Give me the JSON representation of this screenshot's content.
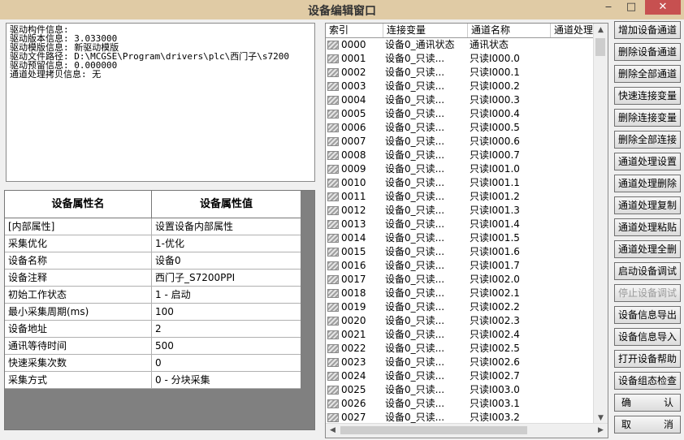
{
  "window": {
    "title": "设备编辑窗口"
  },
  "window_buttons": {
    "minimize": "‒",
    "maximize": "□",
    "close": "✕"
  },
  "info_lines": [
    "驱动构件信息:",
    "驱动版本信息: 3.033000",
    "驱动模版信息: 新驱动模版",
    "驱动文件路径: D:\\MCGSE\\Program\\drivers\\plc\\西门子\\s7200",
    "驱动预留信息: 0.000000",
    "通道处理拷贝信息: 无"
  ],
  "properties": {
    "header_name": "设备属性名",
    "header_value": "设备属性值",
    "rows": [
      {
        "name": "[内部属性]",
        "value": "设置设备内部属性"
      },
      {
        "name": "采集优化",
        "value": "1-优化"
      },
      {
        "name": "设备名称",
        "value": "设备0"
      },
      {
        "name": "设备注释",
        "value": "西门子_S7200PPI"
      },
      {
        "name": "初始工作状态",
        "value": "1 - 启动"
      },
      {
        "name": "最小采集周期(ms)",
        "value": "100"
      },
      {
        "name": "设备地址",
        "value": "2"
      },
      {
        "name": "通讯等待时间",
        "value": "500"
      },
      {
        "name": "快速采集次数",
        "value": "0"
      },
      {
        "name": "采集方式",
        "value": "0 - 分块采集"
      }
    ]
  },
  "channels": {
    "columns": [
      "索引",
      "连接变量",
      "通道名称",
      "通道处理"
    ],
    "rows": [
      {
        "index": "0000",
        "var": "设备0_通讯状态",
        "name": "通讯状态"
      },
      {
        "index": "0001",
        "var": "设备0_只读...",
        "name": "只读I000.0"
      },
      {
        "index": "0002",
        "var": "设备0_只读...",
        "name": "只读I000.1"
      },
      {
        "index": "0003",
        "var": "设备0_只读...",
        "name": "只读I000.2"
      },
      {
        "index": "0004",
        "var": "设备0_只读...",
        "name": "只读I000.3"
      },
      {
        "index": "0005",
        "var": "设备0_只读...",
        "name": "只读I000.4"
      },
      {
        "index": "0006",
        "var": "设备0_只读...",
        "name": "只读I000.5"
      },
      {
        "index": "0007",
        "var": "设备0_只读...",
        "name": "只读I000.6"
      },
      {
        "index": "0008",
        "var": "设备0_只读...",
        "name": "只读I000.7"
      },
      {
        "index": "0009",
        "var": "设备0_只读...",
        "name": "只读I001.0"
      },
      {
        "index": "0010",
        "var": "设备0_只读...",
        "name": "只读I001.1"
      },
      {
        "index": "0011",
        "var": "设备0_只读...",
        "name": "只读I001.2"
      },
      {
        "index": "0012",
        "var": "设备0_只读...",
        "name": "只读I001.3"
      },
      {
        "index": "0013",
        "var": "设备0_只读...",
        "name": "只读I001.4"
      },
      {
        "index": "0014",
        "var": "设备0_只读...",
        "name": "只读I001.5"
      },
      {
        "index": "0015",
        "var": "设备0_只读...",
        "name": "只读I001.6"
      },
      {
        "index": "0016",
        "var": "设备0_只读...",
        "name": "只读I001.7"
      },
      {
        "index": "0017",
        "var": "设备0_只读...",
        "name": "只读I002.0"
      },
      {
        "index": "0018",
        "var": "设备0_只读...",
        "name": "只读I002.1"
      },
      {
        "index": "0019",
        "var": "设备0_只读...",
        "name": "只读I002.2"
      },
      {
        "index": "0020",
        "var": "设备0_只读...",
        "name": "只读I002.3"
      },
      {
        "index": "0021",
        "var": "设备0_只读...",
        "name": "只读I002.4"
      },
      {
        "index": "0022",
        "var": "设备0_只读...",
        "name": "只读I002.5"
      },
      {
        "index": "0023",
        "var": "设备0_只读...",
        "name": "只读I002.6"
      },
      {
        "index": "0024",
        "var": "设备0_只读...",
        "name": "只读I002.7"
      },
      {
        "index": "0025",
        "var": "设备0_只读...",
        "name": "只读I003.0"
      },
      {
        "index": "0026",
        "var": "设备0_只读...",
        "name": "只读I003.1"
      },
      {
        "index": "0027",
        "var": "设备0_只读...",
        "name": "只读I003.2"
      }
    ]
  },
  "buttons": [
    {
      "label": "增加设备通道",
      "disabled": false
    },
    {
      "label": "删除设备通道",
      "disabled": false
    },
    {
      "label": "删除全部通道",
      "disabled": false
    },
    {
      "label": "快速连接变量",
      "disabled": false
    },
    {
      "label": "删除连接变量",
      "disabled": false
    },
    {
      "label": "删除全部连接",
      "disabled": false
    },
    {
      "label": "通道处理设置",
      "disabled": false
    },
    {
      "label": "通道处理删除",
      "disabled": false
    },
    {
      "label": "通道处理复制",
      "disabled": false
    },
    {
      "label": "通道处理粘贴",
      "disabled": false
    },
    {
      "label": "通道处理全删",
      "disabled": false
    },
    {
      "label": "启动设备调试",
      "disabled": false
    },
    {
      "label": "停止设备调试",
      "disabled": true
    },
    {
      "label": "设备信息导出",
      "disabled": false
    },
    {
      "label": "设备信息导入",
      "disabled": false
    },
    {
      "label": "打开设备帮助",
      "disabled": false
    },
    {
      "label": "设备组态检查",
      "disabled": false
    }
  ],
  "confirm_buttons": [
    {
      "left": "确",
      "right": "认"
    },
    {
      "left": "取",
      "right": "消"
    }
  ],
  "colors": {
    "titlebar": "#e0cba5",
    "close_button": "#c75050",
    "grid_background": "#808080"
  }
}
